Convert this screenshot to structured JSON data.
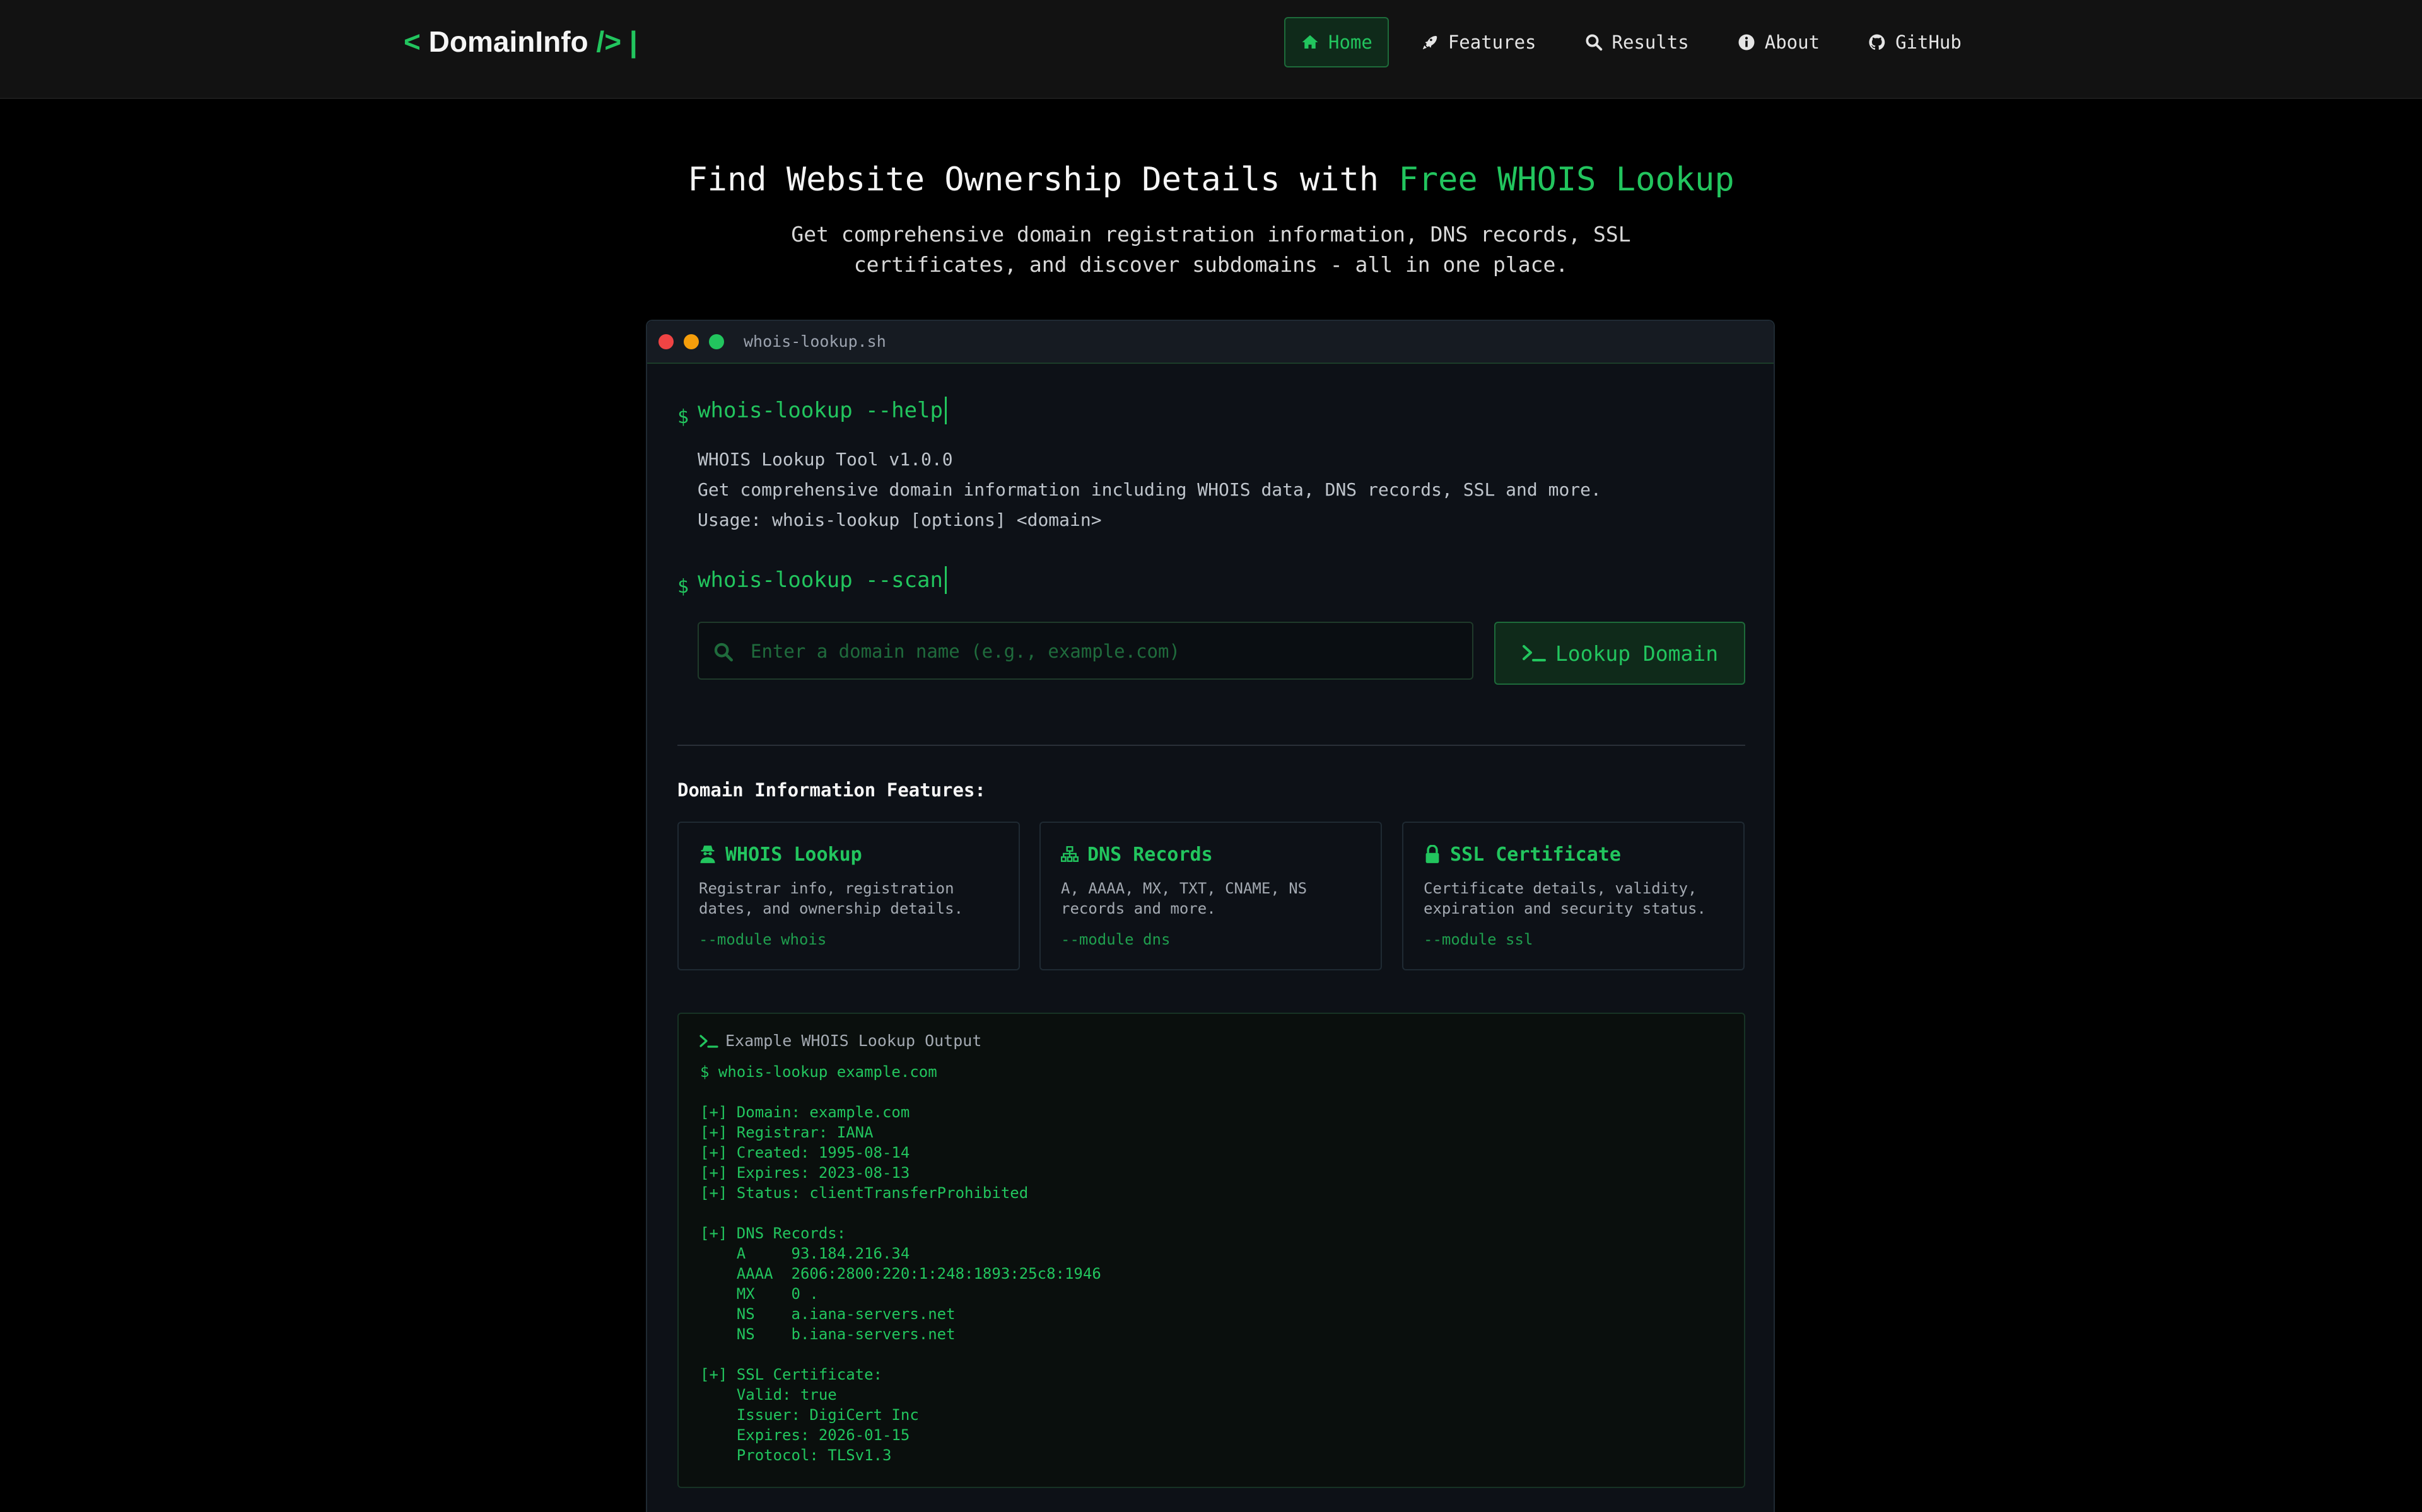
{
  "nav": {
    "logo": {
      "open": "<",
      "name": "DomainInfo",
      "close": "/>",
      "cursor": "|"
    },
    "links": [
      {
        "label": "Home",
        "icon": "home-icon",
        "active": true
      },
      {
        "label": "Features",
        "icon": "rocket-icon",
        "active": false
      },
      {
        "label": "Results",
        "icon": "search-icon",
        "active": false
      },
      {
        "label": "About",
        "icon": "info-icon",
        "active": false
      },
      {
        "label": "GitHub",
        "icon": "github-icon",
        "active": false
      }
    ]
  },
  "hero": {
    "title_prefix": "Find Website Ownership Details with",
    "title_highlight": "Free WHOIS Lookup",
    "subtitle": "Get comprehensive domain registration information, DNS records, SSL certificates, and discover subdomains - all in one place."
  },
  "terminal": {
    "title": "whois-lookup.sh",
    "prompt_symbol": "$",
    "help_command": "whois-lookup --help",
    "help_output": [
      "WHOIS Lookup Tool v1.0.0",
      "Get comprehensive domain information including WHOIS data, DNS records, SSL and more.",
      "Usage: whois-lookup [options] <domain>"
    ],
    "scan_command": "whois-lookup --scan",
    "search": {
      "placeholder": "Enter a domain name (e.g., example.com)",
      "value": ""
    },
    "lookup_button": "Lookup Domain",
    "features_heading": "Domain Information Features:",
    "features": [
      {
        "icon": "user-secret-icon",
        "title": "WHOIS Lookup",
        "description": "Registrar info, registration dates, and ownership details.",
        "flag": "--module whois"
      },
      {
        "icon": "sitemap-icon",
        "title": "DNS Records",
        "description": "A, AAAA, MX, TXT, CNAME, NS records and more.",
        "flag": "--module dns"
      },
      {
        "icon": "lock-icon",
        "title": "SSL Certificate",
        "description": "Certificate details, validity, expiration and security status.",
        "flag": "--module ssl"
      }
    ],
    "example": {
      "header": "Example WHOIS Lookup Output",
      "lines": "$ whois-lookup example.com\n\n[+] Domain: example.com\n[+] Registrar: IANA\n[+] Created: 1995-08-14\n[+] Expires: 2023-08-13\n[+] Status: clientTransferProhibited\n\n[+] DNS Records:\n    A     93.184.216.34\n    AAAA  2606:2800:220:1:248:1893:25c8:1946\n    MX    0 .\n    NS    a.iana-servers.net\n    NS    b.iana-servers.net\n\n[+] SSL Certificate:\n    Valid: true\n    Issuer: DigiCert Inc\n    Expires: 2026-01-15\n    Protocol: TLSv1.3"
    }
  },
  "colors": {
    "accent": "#22c55e",
    "background": "#000000",
    "panel": "#0d1117",
    "nav": "#121212"
  }
}
